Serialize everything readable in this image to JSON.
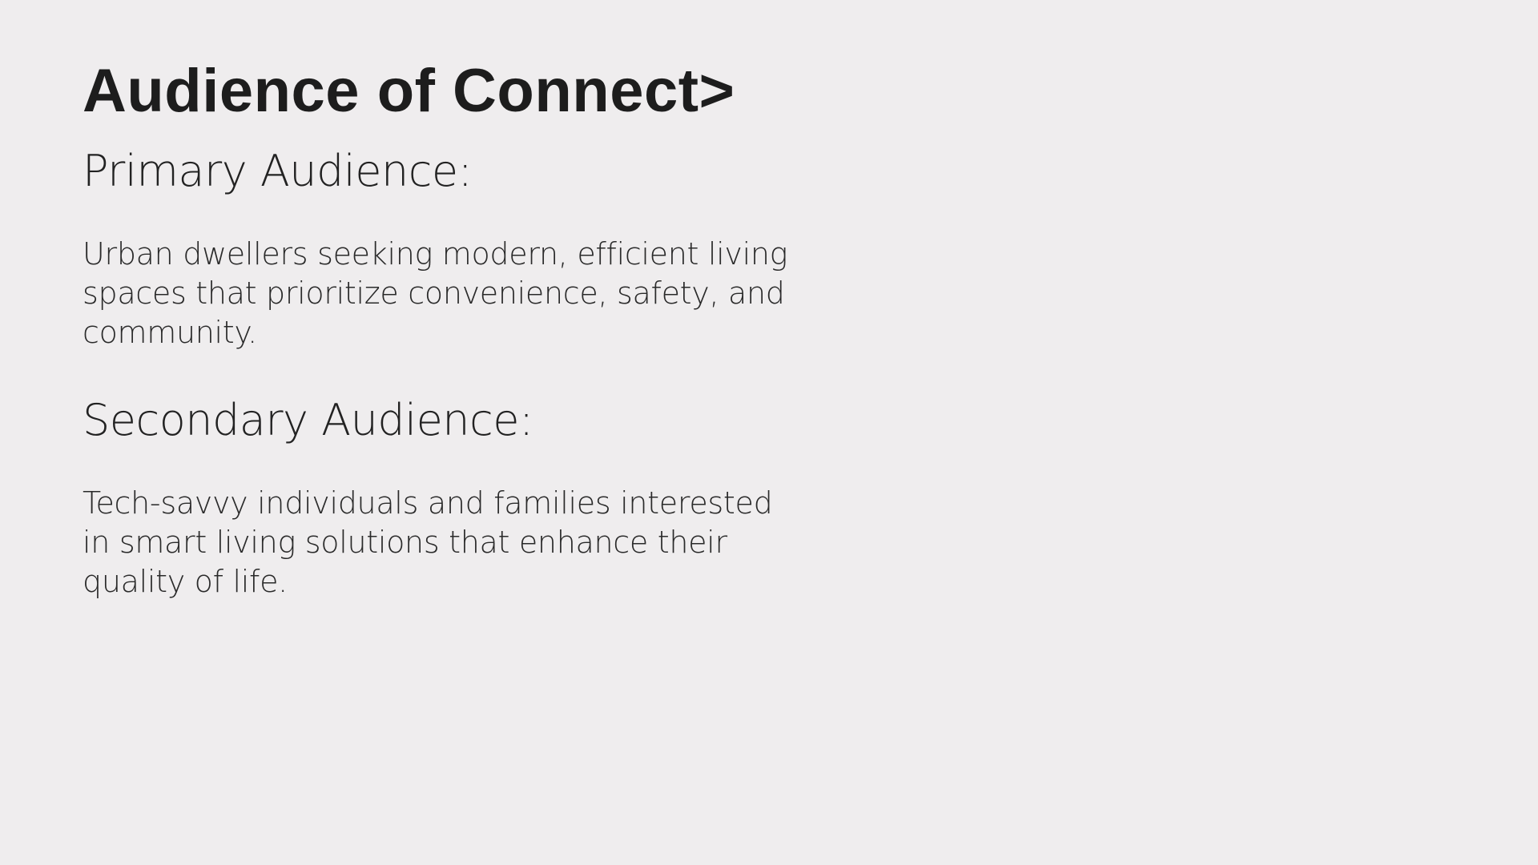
{
  "slide": {
    "title": "Audience of Connect>",
    "primary": {
      "heading": "Primary Audience:",
      "body": "Urban dwellers seeking modern, efficient living spaces that prioritize convenience, safety, and community."
    },
    "secondary": {
      "heading": "Secondary Audience:",
      "body": "Tech-savvy individuals and families interested in smart living solutions that enhance their quality of life."
    }
  },
  "colors": {
    "background": "#efedee",
    "text": "#1d1d1d"
  }
}
